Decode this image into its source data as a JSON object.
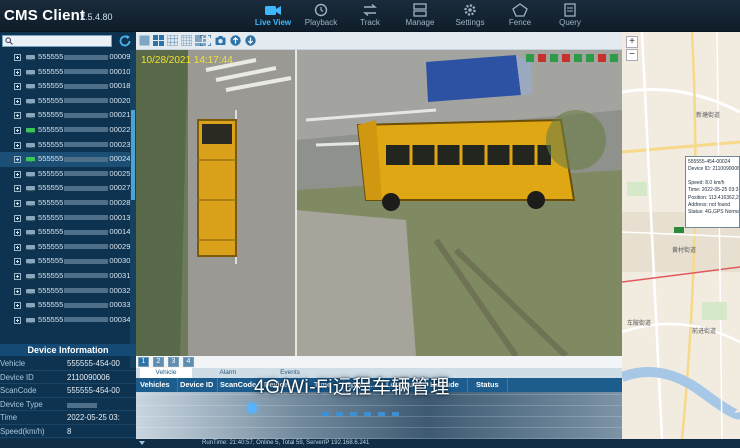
{
  "app": {
    "title": "CMS Client",
    "version": "2.5.4.80"
  },
  "nav": [
    {
      "label": "Live View",
      "icon": "video-camera-icon",
      "active": true
    },
    {
      "label": "Playback",
      "icon": "playback-clock-icon",
      "active": false
    },
    {
      "label": "Track",
      "icon": "track-arrows-icon",
      "active": false
    },
    {
      "label": "Manage",
      "icon": "manage-server-icon",
      "active": false
    },
    {
      "label": "Settings",
      "icon": "gear-icon",
      "active": false
    },
    {
      "label": "Fence",
      "icon": "fence-icon",
      "active": false
    },
    {
      "label": "Query",
      "icon": "query-document-icon",
      "active": false
    }
  ],
  "tree": {
    "search_placeholder": "",
    "items": [
      {
        "prefix": "555555",
        "suffix": "00009"
      },
      {
        "prefix": "555555",
        "suffix": "00010"
      },
      {
        "prefix": "555555",
        "suffix": "00018"
      },
      {
        "prefix": "555555",
        "suffix": "00020"
      },
      {
        "prefix": "555555",
        "suffix": "00021"
      },
      {
        "prefix": "555555",
        "suffix": "00022"
      },
      {
        "prefix": "555555",
        "suffix": "00023"
      },
      {
        "prefix": "555555",
        "suffix": "00024"
      },
      {
        "prefix": "555555",
        "suffix": "00025"
      },
      {
        "prefix": "555555",
        "suffix": "00027"
      },
      {
        "prefix": "555555",
        "suffix": "00028"
      },
      {
        "prefix": "555555",
        "suffix": "00013"
      },
      {
        "prefix": "555555",
        "suffix": "00014"
      },
      {
        "prefix": "555555",
        "suffix": "00029"
      },
      {
        "prefix": "555555",
        "suffix": "00030"
      },
      {
        "prefix": "555555",
        "suffix": "00031"
      },
      {
        "prefix": "555555",
        "suffix": "00032"
      },
      {
        "prefix": "555555",
        "suffix": "00033"
      },
      {
        "prefix": "555555",
        "suffix": "00034"
      }
    ]
  },
  "device_info": {
    "heading": "Device Information",
    "rows": [
      {
        "key": "Vehicle",
        "value": "555555-454-00"
      },
      {
        "key": "Device ID",
        "value": "2110090006"
      },
      {
        "key": "ScanCode",
        "value": "555555-454-00"
      },
      {
        "key": "Device Type",
        "value": ""
      },
      {
        "key": "Time",
        "value": "2022-05-25 03:"
      },
      {
        "key": "Speed(km/h)",
        "value": "8"
      }
    ]
  },
  "video": {
    "timestamp": "10/28/2021 14:17:44"
  },
  "channel_tabs": [
    "1",
    "2",
    "3",
    "4"
  ],
  "bottom_tabs": [
    "Vehicle",
    "Alarm",
    "Events"
  ],
  "table": {
    "columns": [
      "Vehicles",
      "Device ID",
      "ScanCode",
      "Device ...",
      "Time",
      "Speed(...",
      "Longitude",
      "Latitude",
      "Status"
    ]
  },
  "caption": "4G/Wi-Fi远程车辆管理",
  "map": {
    "zoom_in": "+",
    "zoom_out": "−",
    "card": {
      "title": "555555-454-00024",
      "device_id": "Device ID: 2110090006",
      "speed": "Speed: 8.0 km/h",
      "time": "Time: 2022-05-25 03:3",
      "position": "Position: 113.416362,2",
      "address": "Address: not found",
      "status": "Status: 4G,GPS Norma"
    },
    "labels": [
      "新塘街道",
      "黄村街道",
      "车陂街道",
      "前进街道"
    ]
  },
  "status_bar": {
    "text": "RunTime: 21:40:57, Online 5, Total 59, ServerIP 192.168.6.241"
  },
  "colors": {
    "accent": "#3fb7ff",
    "header": "#1c5d8e",
    "panel": "#0e3350"
  }
}
